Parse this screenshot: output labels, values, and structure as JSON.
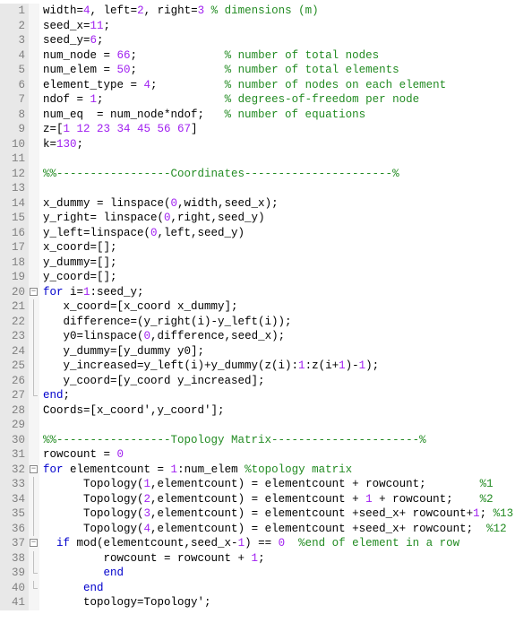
{
  "code": {
    "lines": [
      {
        "n": 1,
        "seg": [
          {
            "c": "id",
            "t": "width"
          },
          {
            "c": "op",
            "t": "="
          },
          {
            "c": "n",
            "t": "4"
          },
          {
            "c": "id",
            "t": ", left"
          },
          {
            "c": "op",
            "t": "="
          },
          {
            "c": "n",
            "t": "2"
          },
          {
            "c": "id",
            "t": ", right"
          },
          {
            "c": "op",
            "t": "="
          },
          {
            "c": "n",
            "t": "3"
          },
          {
            "c": "id",
            "t": " "
          },
          {
            "c": "c",
            "t": "% dimensions (m)"
          }
        ],
        "fold": null
      },
      {
        "n": 2,
        "seg": [
          {
            "c": "id",
            "t": "seed_x"
          },
          {
            "c": "op",
            "t": "="
          },
          {
            "c": "n",
            "t": "11"
          },
          {
            "c": "id",
            "t": ";"
          }
        ],
        "fold": null
      },
      {
        "n": 3,
        "seg": [
          {
            "c": "id",
            "t": "seed_y"
          },
          {
            "c": "op",
            "t": "="
          },
          {
            "c": "n",
            "t": "6"
          },
          {
            "c": "id",
            "t": ";"
          }
        ],
        "fold": null
      },
      {
        "n": 4,
        "seg": [
          {
            "c": "id",
            "t": "num_node = "
          },
          {
            "c": "n",
            "t": "66"
          },
          {
            "c": "id",
            "t": ";             "
          },
          {
            "c": "c",
            "t": "% number of total nodes"
          }
        ],
        "fold": null
      },
      {
        "n": 5,
        "seg": [
          {
            "c": "id",
            "t": "num_elem = "
          },
          {
            "c": "n",
            "t": "50"
          },
          {
            "c": "id",
            "t": ";             "
          },
          {
            "c": "c",
            "t": "% number of total elements"
          }
        ],
        "fold": null
      },
      {
        "n": 6,
        "seg": [
          {
            "c": "id",
            "t": "element_type = "
          },
          {
            "c": "n",
            "t": "4"
          },
          {
            "c": "id",
            "t": ";          "
          },
          {
            "c": "c",
            "t": "% number of nodes on each element"
          }
        ],
        "fold": null
      },
      {
        "n": 7,
        "seg": [
          {
            "c": "id",
            "t": "ndof = "
          },
          {
            "c": "n",
            "t": "1"
          },
          {
            "c": "id",
            "t": ";                  "
          },
          {
            "c": "c",
            "t": "% degrees-of-freedom per node"
          }
        ],
        "fold": null
      },
      {
        "n": 8,
        "seg": [
          {
            "c": "id",
            "t": "num_eq  = num_node*ndof;   "
          },
          {
            "c": "c",
            "t": "% number of equations"
          }
        ],
        "fold": null
      },
      {
        "n": 9,
        "seg": [
          {
            "c": "id",
            "t": "z=["
          },
          {
            "c": "n",
            "t": "1 12 23 34 45 56 67"
          },
          {
            "c": "id",
            "t": "]"
          }
        ],
        "fold": null
      },
      {
        "n": 10,
        "seg": [
          {
            "c": "id",
            "t": "k="
          },
          {
            "c": "n",
            "t": "130"
          },
          {
            "c": "id",
            "t": ";"
          }
        ],
        "fold": null
      },
      {
        "n": 11,
        "seg": [],
        "fold": null
      },
      {
        "n": 12,
        "seg": [
          {
            "c": "c",
            "t": "%%-----------------Coordinates----------------------%"
          }
        ],
        "fold": null
      },
      {
        "n": 13,
        "seg": [],
        "fold": null
      },
      {
        "n": 14,
        "seg": [
          {
            "c": "id",
            "t": "x_dummy = linspace("
          },
          {
            "c": "n",
            "t": "0"
          },
          {
            "c": "id",
            "t": ",width,seed_x);"
          }
        ],
        "fold": null
      },
      {
        "n": 15,
        "seg": [
          {
            "c": "id",
            "t": "y_right= linspace("
          },
          {
            "c": "n",
            "t": "0"
          },
          {
            "c": "id",
            "t": ",right,seed_y)"
          }
        ],
        "fold": null
      },
      {
        "n": 16,
        "seg": [
          {
            "c": "id",
            "t": "y_left=linspace("
          },
          {
            "c": "n",
            "t": "0"
          },
          {
            "c": "id",
            "t": ",left,seed_y)"
          }
        ],
        "fold": null
      },
      {
        "n": 17,
        "seg": [
          {
            "c": "id",
            "t": "x_coord=[];"
          }
        ],
        "fold": null
      },
      {
        "n": 18,
        "seg": [
          {
            "c": "id",
            "t": "y_dummy=[];"
          }
        ],
        "fold": null
      },
      {
        "n": 19,
        "seg": [
          {
            "c": "id",
            "t": "y_coord=[];"
          }
        ],
        "fold": null
      },
      {
        "n": 20,
        "seg": [
          {
            "c": "k",
            "t": "for"
          },
          {
            "c": "id",
            "t": " i="
          },
          {
            "c": "n",
            "t": "1"
          },
          {
            "c": "id",
            "t": ":seed_y;"
          }
        ],
        "fold": "open"
      },
      {
        "n": 21,
        "seg": [
          {
            "c": "id",
            "t": "   x_coord=[x_coord x_dummy];"
          }
        ],
        "fold": "mid"
      },
      {
        "n": 22,
        "seg": [
          {
            "c": "id",
            "t": "   difference=(y_right(i)-y_left(i));"
          }
        ],
        "fold": "mid"
      },
      {
        "n": 23,
        "seg": [
          {
            "c": "id",
            "t": "   y0=linspace("
          },
          {
            "c": "n",
            "t": "0"
          },
          {
            "c": "id",
            "t": ",difference,seed_x);"
          }
        ],
        "fold": "mid"
      },
      {
        "n": 24,
        "seg": [
          {
            "c": "id",
            "t": "   y_dummy=[y_dummy y0];"
          }
        ],
        "fold": "mid"
      },
      {
        "n": 25,
        "seg": [
          {
            "c": "id",
            "t": "   y_increased=y_left(i)+y_dummy(z(i):"
          },
          {
            "c": "n",
            "t": "1"
          },
          {
            "c": "id",
            "t": ":z(i+"
          },
          {
            "c": "n",
            "t": "1"
          },
          {
            "c": "id",
            "t": ")-"
          },
          {
            "c": "n",
            "t": "1"
          },
          {
            "c": "id",
            "t": ");"
          }
        ],
        "fold": "mid"
      },
      {
        "n": 26,
        "seg": [
          {
            "c": "id",
            "t": "   y_coord=[y_coord y_increased];"
          }
        ],
        "fold": "mid"
      },
      {
        "n": 27,
        "seg": [
          {
            "c": "k",
            "t": "end"
          },
          {
            "c": "id",
            "t": ";"
          }
        ],
        "fold": "end"
      },
      {
        "n": 28,
        "seg": [
          {
            "c": "id",
            "t": "Coords=[x_coord',y_coord'];"
          }
        ],
        "fold": null
      },
      {
        "n": 29,
        "seg": [],
        "fold": null
      },
      {
        "n": 30,
        "seg": [
          {
            "c": "c",
            "t": "%%-----------------Topology Matrix----------------------%"
          }
        ],
        "fold": null
      },
      {
        "n": 31,
        "seg": [
          {
            "c": "id",
            "t": "rowcount = "
          },
          {
            "c": "n",
            "t": "0"
          }
        ],
        "fold": null
      },
      {
        "n": 32,
        "seg": [
          {
            "c": "k",
            "t": "for"
          },
          {
            "c": "id",
            "t": " elementcount = "
          },
          {
            "c": "n",
            "t": "1"
          },
          {
            "c": "id",
            "t": ":num_elem "
          },
          {
            "c": "c",
            "t": "%topology matrix"
          }
        ],
        "fold": "open"
      },
      {
        "n": 33,
        "seg": [
          {
            "c": "id",
            "t": "      Topology("
          },
          {
            "c": "n",
            "t": "1"
          },
          {
            "c": "id",
            "t": ",elementcount) = elementcount + rowcount;        "
          },
          {
            "c": "c",
            "t": "%1"
          }
        ],
        "fold": "mid"
      },
      {
        "n": 34,
        "seg": [
          {
            "c": "id",
            "t": "      Topology("
          },
          {
            "c": "n",
            "t": "2"
          },
          {
            "c": "id",
            "t": ",elementcount) = elementcount + "
          },
          {
            "c": "n",
            "t": "1"
          },
          {
            "c": "id",
            "t": " + rowcount;    "
          },
          {
            "c": "c",
            "t": "%2"
          }
        ],
        "fold": "mid"
      },
      {
        "n": 35,
        "seg": [
          {
            "c": "id",
            "t": "      Topology("
          },
          {
            "c": "n",
            "t": "3"
          },
          {
            "c": "id",
            "t": ",elementcount) = elementcount +seed_x+ rowcount+"
          },
          {
            "c": "n",
            "t": "1"
          },
          {
            "c": "id",
            "t": "; "
          },
          {
            "c": "c",
            "t": "%13"
          }
        ],
        "fold": "mid"
      },
      {
        "n": 36,
        "seg": [
          {
            "c": "id",
            "t": "      Topology("
          },
          {
            "c": "n",
            "t": "4"
          },
          {
            "c": "id",
            "t": ",elementcount) = elementcount +seed_x+ rowcount;  "
          },
          {
            "c": "c",
            "t": "%12"
          }
        ],
        "fold": "mid"
      },
      {
        "n": 37,
        "seg": [
          {
            "c": "id",
            "t": "  "
          },
          {
            "c": "k",
            "t": "if"
          },
          {
            "c": "id",
            "t": " mod(elementcount,seed_x-"
          },
          {
            "c": "n",
            "t": "1"
          },
          {
            "c": "id",
            "t": ") == "
          },
          {
            "c": "n",
            "t": "0"
          },
          {
            "c": "id",
            "t": "  "
          },
          {
            "c": "c",
            "t": "%end of element in a row"
          }
        ],
        "fold": "open2"
      },
      {
        "n": 38,
        "seg": [
          {
            "c": "id",
            "t": "         rowcount = rowcount + "
          },
          {
            "c": "n",
            "t": "1"
          },
          {
            "c": "id",
            "t": ";"
          }
        ],
        "fold": "mid2"
      },
      {
        "n": 39,
        "seg": [
          {
            "c": "id",
            "t": "         "
          },
          {
            "c": "k",
            "t": "end"
          }
        ],
        "fold": "end2"
      },
      {
        "n": 40,
        "seg": [
          {
            "c": "id",
            "t": "      "
          },
          {
            "c": "k",
            "t": "end"
          }
        ],
        "fold": "end"
      },
      {
        "n": 41,
        "seg": [
          {
            "c": "id",
            "t": "      topology=Topology';"
          }
        ],
        "fold": null
      }
    ]
  }
}
